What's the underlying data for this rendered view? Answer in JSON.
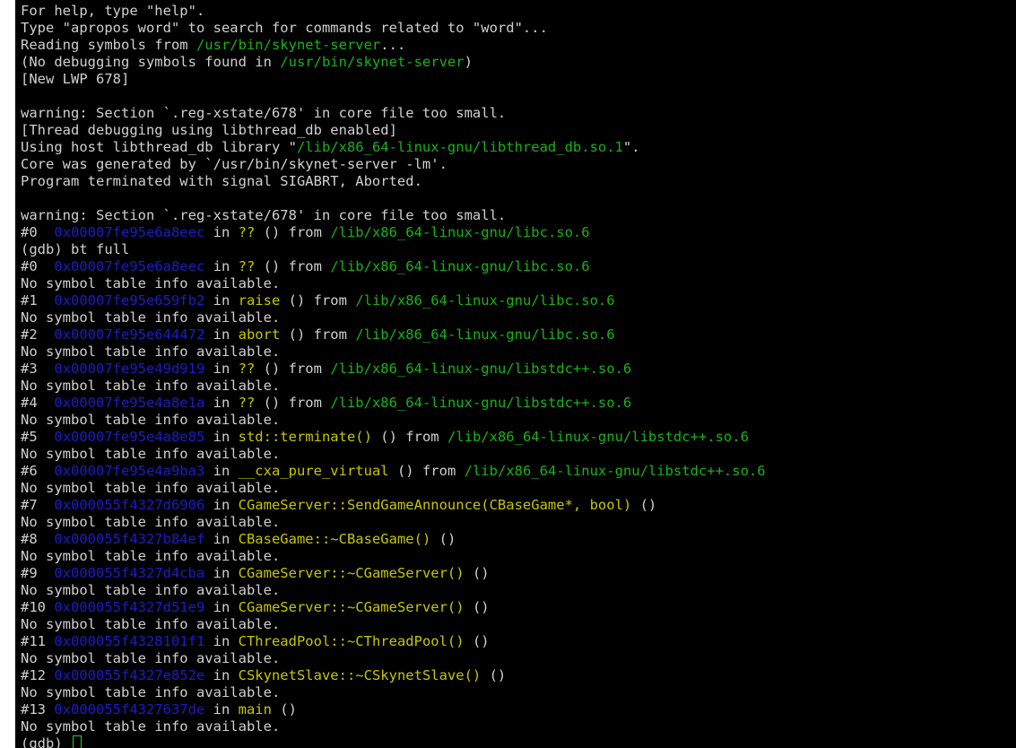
{
  "colors": {
    "background": "#000000",
    "default": "#d0d0d0",
    "path": "#16b316",
    "address": "#1c1cc8",
    "function": "#c6c600",
    "cursor": "#21d421"
  },
  "terminal": {
    "lines": [
      [
        [
          "default",
          "For help, type \"help\"."
        ]
      ],
      [
        [
          "default",
          "Type \"apropos word\" to search for commands related to \"word\"..."
        ]
      ],
      [
        [
          "default",
          "Reading symbols from "
        ],
        [
          "green",
          "/usr/bin/skynet-server"
        ],
        [
          "default",
          "..."
        ]
      ],
      [
        [
          "default",
          "(No debugging symbols found in "
        ],
        [
          "green",
          "/usr/bin/skynet-server"
        ],
        [
          "default",
          ")"
        ]
      ],
      [
        [
          "default",
          "[New LWP 678]"
        ]
      ],
      [],
      [
        [
          "default",
          "warning: Section `.reg-xstate/678' in core file too small."
        ]
      ],
      [
        [
          "default",
          "[Thread debugging using libthread_db enabled]"
        ]
      ],
      [
        [
          "default",
          "Using host libthread_db library \""
        ],
        [
          "green",
          "/lib/x86_64-linux-gnu/libthread_db.so.1"
        ],
        [
          "default",
          "\"."
        ]
      ],
      [
        [
          "default",
          "Core was generated by `/usr/bin/skynet-server -lm'."
        ]
      ],
      [
        [
          "default",
          "Program terminated with signal SIGABRT, Aborted."
        ]
      ],
      [],
      [
        [
          "default",
          "warning: Section `.reg-xstate/678' in core file too small."
        ]
      ],
      [
        [
          "default",
          "#0  "
        ],
        [
          "blue",
          "0x00007fe95e6a8eec"
        ],
        [
          "default",
          " in "
        ],
        [
          "yellow",
          "??"
        ],
        [
          "default",
          " () from "
        ],
        [
          "green",
          "/lib/x86_64-linux-gnu/libc.so.6"
        ]
      ],
      [
        [
          "default",
          "(gdb) bt full"
        ]
      ],
      [
        [
          "default",
          "#0  "
        ],
        [
          "blue",
          "0x00007fe95e6a8eec"
        ],
        [
          "default",
          " in "
        ],
        [
          "yellow",
          "??"
        ],
        [
          "default",
          " () from "
        ],
        [
          "green",
          "/lib/x86_64-linux-gnu/libc.so.6"
        ]
      ],
      [
        [
          "default",
          "No symbol table info available."
        ]
      ],
      [
        [
          "default",
          "#1  "
        ],
        [
          "blue",
          "0x00007fe95e659fb2"
        ],
        [
          "default",
          " in "
        ],
        [
          "yellow",
          "raise"
        ],
        [
          "default",
          " () from "
        ],
        [
          "green",
          "/lib/x86_64-linux-gnu/libc.so.6"
        ]
      ],
      [
        [
          "default",
          "No symbol table info available."
        ]
      ],
      [
        [
          "default",
          "#2  "
        ],
        [
          "blue",
          "0x00007fe95e644472"
        ],
        [
          "default",
          " in "
        ],
        [
          "yellow",
          "abort"
        ],
        [
          "default",
          " () from "
        ],
        [
          "green",
          "/lib/x86_64-linux-gnu/libc.so.6"
        ]
      ],
      [
        [
          "default",
          "No symbol table info available."
        ]
      ],
      [
        [
          "default",
          "#3  "
        ],
        [
          "blue",
          "0x00007fe95e49d919"
        ],
        [
          "default",
          " in "
        ],
        [
          "yellow",
          "??"
        ],
        [
          "default",
          " () from "
        ],
        [
          "green",
          "/lib/x86_64-linux-gnu/libstdc++.so.6"
        ]
      ],
      [
        [
          "default",
          "No symbol table info available."
        ]
      ],
      [
        [
          "default",
          "#4  "
        ],
        [
          "blue",
          "0x00007fe95e4a8e1a"
        ],
        [
          "default",
          " in "
        ],
        [
          "yellow",
          "??"
        ],
        [
          "default",
          " () from "
        ],
        [
          "green",
          "/lib/x86_64-linux-gnu/libstdc++.so.6"
        ]
      ],
      [
        [
          "default",
          "No symbol table info available."
        ]
      ],
      [
        [
          "default",
          "#5  "
        ],
        [
          "blue",
          "0x00007fe95e4a8e85"
        ],
        [
          "default",
          " in "
        ],
        [
          "yellow",
          "std::terminate()"
        ],
        [
          "default",
          " () from "
        ],
        [
          "green",
          "/lib/x86_64-linux-gnu/libstdc++.so.6"
        ]
      ],
      [
        [
          "default",
          "No symbol table info available."
        ]
      ],
      [
        [
          "default",
          "#6  "
        ],
        [
          "blue",
          "0x00007fe95e4a9ba3"
        ],
        [
          "default",
          " in "
        ],
        [
          "yellow",
          "__cxa_pure_virtual"
        ],
        [
          "default",
          " () from "
        ],
        [
          "green",
          "/lib/x86_64-linux-gnu/libstdc++.so.6"
        ]
      ],
      [
        [
          "default",
          "No symbol table info available."
        ]
      ],
      [
        [
          "default",
          "#7  "
        ],
        [
          "blue",
          "0x000055f4327d6906"
        ],
        [
          "default",
          " in "
        ],
        [
          "yellow",
          "CGameServer::SendGameAnnounce(CBaseGame*, bool)"
        ],
        [
          "default",
          " ()"
        ]
      ],
      [
        [
          "default",
          "No symbol table info available."
        ]
      ],
      [
        [
          "default",
          "#8  "
        ],
        [
          "blue",
          "0x000055f4327b84ef"
        ],
        [
          "default",
          " in "
        ],
        [
          "yellow",
          "CBaseGame::~CBaseGame()"
        ],
        [
          "default",
          " ()"
        ]
      ],
      [
        [
          "default",
          "No symbol table info available."
        ]
      ],
      [
        [
          "default",
          "#9  "
        ],
        [
          "blue",
          "0x000055f4327d4cba"
        ],
        [
          "default",
          " in "
        ],
        [
          "yellow",
          "CGameServer::~CGameServer()"
        ],
        [
          "default",
          " ()"
        ]
      ],
      [
        [
          "default",
          "No symbol table info available."
        ]
      ],
      [
        [
          "default",
          "#10 "
        ],
        [
          "blue",
          "0x000055f4327d51e9"
        ],
        [
          "default",
          " in "
        ],
        [
          "yellow",
          "CGameServer::~CGameServer()"
        ],
        [
          "default",
          " ()"
        ]
      ],
      [
        [
          "default",
          "No symbol table info available."
        ]
      ],
      [
        [
          "default",
          "#11 "
        ],
        [
          "blue",
          "0x000055f4328101f1"
        ],
        [
          "default",
          " in "
        ],
        [
          "yellow",
          "CThreadPool::~CThreadPool()"
        ],
        [
          "default",
          " ()"
        ]
      ],
      [
        [
          "default",
          "No symbol table info available."
        ]
      ],
      [
        [
          "default",
          "#12 "
        ],
        [
          "blue",
          "0x000055f4327e852e"
        ],
        [
          "default",
          " in "
        ],
        [
          "yellow",
          "CSkynetSlave::~CSkynetSlave()"
        ],
        [
          "default",
          " ()"
        ]
      ],
      [
        [
          "default",
          "No symbol table info available."
        ]
      ],
      [
        [
          "default",
          "#13 "
        ],
        [
          "blue",
          "0x000055f4327637de"
        ],
        [
          "default",
          " in "
        ],
        [
          "yellow",
          "main"
        ],
        [
          "default",
          " ()"
        ]
      ],
      [
        [
          "default",
          "No symbol table info available."
        ]
      ]
    ],
    "prompt": "(gdb) "
  }
}
